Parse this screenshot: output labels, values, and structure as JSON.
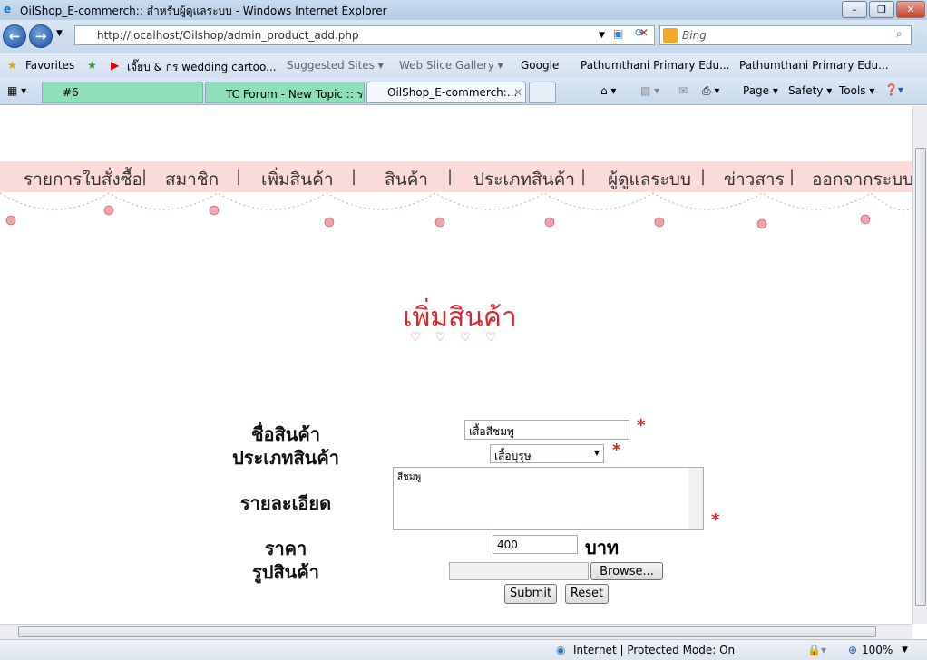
{
  "window": {
    "title": "OilShop_E-commerch:: สำหรับผู้ดูแลระบบ - Windows Internet Explorer"
  },
  "address": {
    "url": "http://localhost/Oilshop/admin_product_add.php",
    "search_placeholder": "Bing"
  },
  "favorites": {
    "label": "Favorites",
    "items": [
      "เจี๊ยบ & กร wedding cartoo...",
      "Suggested Sites ▾",
      "Web Slice Gallery ▾",
      "Google",
      "Pathumthani Primary Edu...",
      "Pathumthani Primary Edu..."
    ]
  },
  "tabs": [
    {
      "label": "#6"
    },
    {
      "label": "TC Forum - New Topic :: ร..."
    },
    {
      "label": "OilShop_E-commerch:..."
    }
  ],
  "commandbar": {
    "page": "Page ▾",
    "safety": "Safety ▾",
    "tools": "Tools ▾"
  },
  "menu": [
    "รายการใบสั่งซื้อ",
    "สมาชิก",
    "เพิ่มสินค้า",
    "สินค้า",
    "ประเภทสินค้า",
    "ผู้ดูแลระบบ",
    "ข่าวสาร",
    "ออกจากระบบ"
  ],
  "page": {
    "title": "เพิ่มสินค้า"
  },
  "form": {
    "name_label": "ชื่อสินค้า",
    "name_value": "เสื้อสีชมพู",
    "type_label": "ประเภทสินค้า",
    "type_value": "เสื้อบุรุษ",
    "detail_label": "รายละเอียด",
    "detail_value": "สีชมพู",
    "price_label": "ราคา",
    "price_value": "400",
    "price_unit": "บาท",
    "image_label": "รูปสินค้า",
    "browse": "Browse...",
    "submit": "Submit",
    "reset": "Reset",
    "required": "*"
  },
  "status": {
    "zone": "Internet | Protected Mode: On",
    "zoom": "100%"
  },
  "colors": {
    "menu_band": "#fbdada",
    "title": "#d9272e",
    "required": "#dd2222"
  }
}
